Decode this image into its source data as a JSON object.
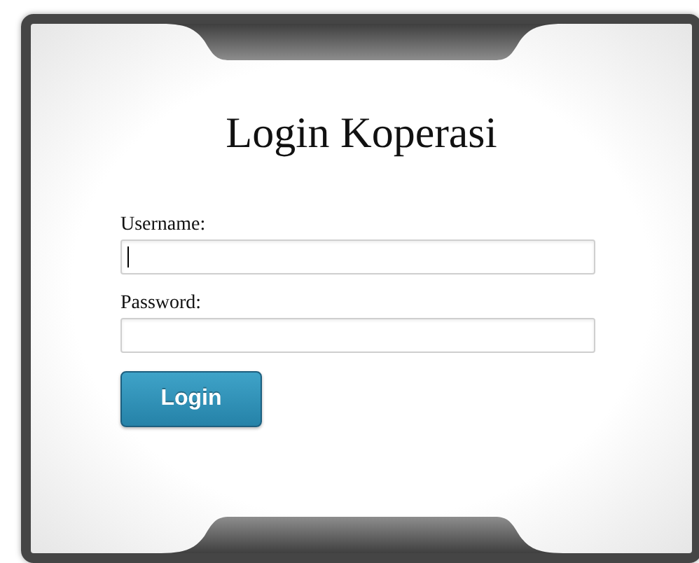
{
  "title": "Login Koperasi",
  "fields": [
    {
      "label": "Username:",
      "focused": true
    },
    {
      "label": "Password:",
      "focused": false
    }
  ],
  "button": "Login"
}
